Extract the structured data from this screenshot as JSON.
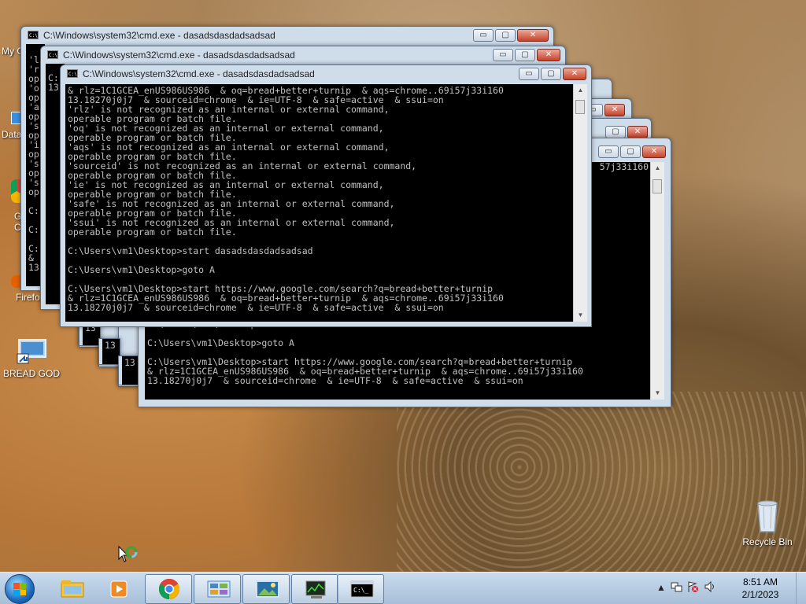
{
  "desktop": {
    "icons": [
      {
        "label": "BREAD GOD",
        "icon": "shortcut-monitor-icon"
      },
      {
        "label": "Recycle Bin",
        "icon": "recycle-bin-icon"
      }
    ],
    "partial_labels": [
      "My C",
      "Data",
      "G",
      "C",
      "Firefo"
    ]
  },
  "windows": {
    "w1_title": "C:\\Windows\\system32\\cmd.exe - dasadsdasdadsadsad",
    "w2_title": "C:\\Windows\\system32\\cmd.exe - dasadsdasdadsadsad",
    "w3_title": "C:\\Windows\\system32\\cmd.exe - dasadsdasdadsadsad",
    "w1_left_text": "\n'l\n'r\nop\n'o\nop\n'a\nop\n's\nop\n'i\nop\n's\nop\n's\nop\n\nC:\n\nC:\n\nC:\n&\n13",
    "w2_left_text": "C:\n13",
    "w3_console": "& rlz=1C1GCEA_enUS986US986  & oq=bread+better+turnip  & aqs=chrome..69i57j33i160\n13.18270j0j7  & sourceid=chrome  & ie=UTF-8  & safe=active  & ssui=on\n'rlz' is not recognized as an internal or external command,\noperable program or batch file.\n'oq' is not recognized as an internal or external command,\noperable program or batch file.\n'aqs' is not recognized as an internal or external command,\noperable program or batch file.\n'sourceid' is not recognized as an internal or external command,\noperable program or batch file.\n'ie' is not recognized as an internal or external command,\noperable program or batch file.\n'safe' is not recognized as an internal or external command,\noperable program or batch file.\n'ssui' is not recognized as an internal or external command,\noperable program or batch file.\n\nC:\\Users\\vm1\\Desktop>start dasadsdasdadsadsad\n\nC:\\Users\\vm1\\Desktop>goto A\n\nC:\\Users\\vm1\\Desktop>start https://www.google.com/search?q=bread+better+turnip\n& rlz=1C1GCEA_enUS986US986  & oq=bread+better+turnip  & aqs=chrome..69i57j33i160\n13.18270j0j7  & sourceid=chrome  & ie=UTF-8  & safe=active  & ssui=on",
    "w4_partial_text": "57j33i160",
    "bottom_console": "C:\\Users\\vm1\\Desktop>start dasadsdasdadsadsad\n\nC:\\Users\\vm1\\Desktop>goto A\n\nC:\\Users\\vm1\\Desktop>start https://www.google.com/search?q=bread+better+turnip\n& rlz=1C1GCEA_enUS986US986  & oq=bread+better+turnip  & aqs=chrome..69i57j33i160\n13.18270j0j7  & sourceid=chrome  & ie=UTF-8  & safe=active  & ssui=on",
    "stack_fragments": [
      "13",
      "13",
      "13"
    ],
    "btn_minimize": "▭",
    "btn_maximize": "▢",
    "btn_close": "✕"
  },
  "taskbar": {
    "clock_time": "8:51 AM",
    "clock_date": "2/1/2023",
    "tray_arrow": "▲",
    "apps": [
      {
        "name": "explorer",
        "icon": "folder-icon"
      },
      {
        "name": "media-player",
        "icon": "media-player-icon"
      },
      {
        "name": "chrome",
        "icon": "chrome-icon"
      },
      {
        "name": "control-panel",
        "icon": "control-panel-icon"
      },
      {
        "name": "photo-viewer",
        "icon": "photo-viewer-icon"
      },
      {
        "name": "task-manager",
        "icon": "task-manager-icon"
      },
      {
        "name": "cmd",
        "icon": "cmd-icon"
      }
    ]
  }
}
